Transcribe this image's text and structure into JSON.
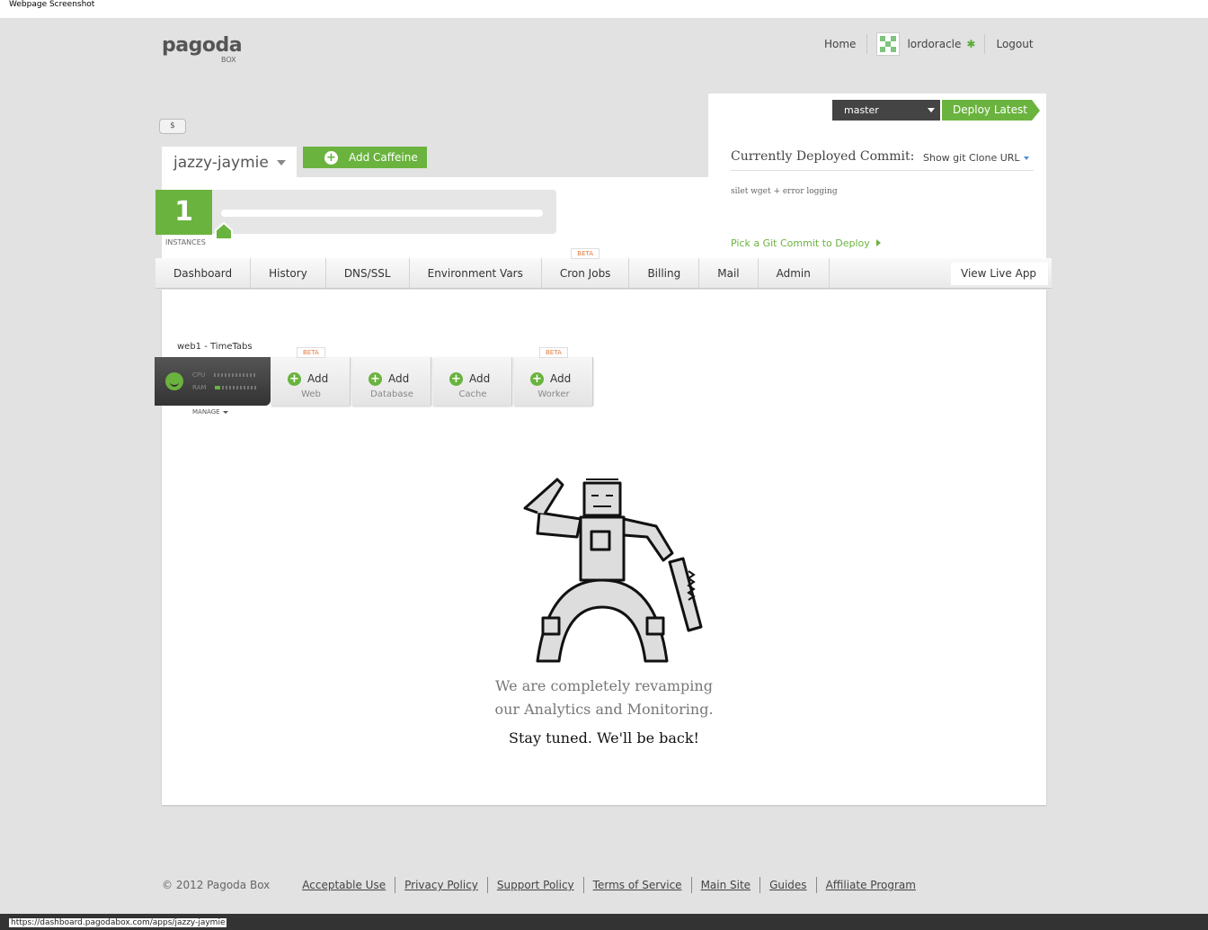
{
  "window": {
    "title": "Webpage Screenshot",
    "status_url": "https://dashboard.pagodabox.com/apps/jazzy-jaymie"
  },
  "logo": {
    "main": "pagoda",
    "sub": "BOX"
  },
  "topnav": {
    "home": "Home",
    "user": "lordoracle",
    "logout": "Logout"
  },
  "app": {
    "dollar": "$",
    "name": "jazzy-jaymie",
    "add_caffeine": "Add Caffeine",
    "instances_count": "1",
    "instances_label": "INSTANCES"
  },
  "deploy": {
    "branch": "master",
    "deploy_latest": "Deploy Latest",
    "current_commit_label": "Currently Deployed Commit:",
    "show_git_clone": "Show git Clone URL",
    "commit_message": "silet wget + error logging",
    "pick_commit": "Pick a Git Commit to Deploy"
  },
  "nav": {
    "tabs": [
      {
        "label": "Dashboard",
        "badge": ""
      },
      {
        "label": "History",
        "badge": ""
      },
      {
        "label": "DNS/SSL",
        "badge": ""
      },
      {
        "label": "Environment Vars",
        "badge": ""
      },
      {
        "label": "Cron Jobs",
        "badge": "BETA"
      },
      {
        "label": "Billing",
        "badge": ""
      },
      {
        "label": "Mail",
        "badge": ""
      },
      {
        "label": "Admin",
        "badge": ""
      }
    ],
    "view_live": "View Live App"
  },
  "components": {
    "web1_label": "web1 - TimeTabs",
    "cpu": "CPU",
    "ram": "RAM",
    "manage": "MANAGE",
    "add_label": "Add",
    "add_web": "Web",
    "add_database": "Database",
    "add_cache": "Cache",
    "add_worker": "Worker",
    "beta": "BETA"
  },
  "message": {
    "line1": "We are completely revamping our Analytics and Monitoring.",
    "line2": "Stay tuned. We'll be back!"
  },
  "footer": {
    "copyright": "© 2012 Pagoda Box",
    "links": [
      "Acceptable Use",
      "Privacy Policy",
      "Support Policy",
      "Terms of Service",
      "Main Site",
      "Guides",
      "Affiliate Program"
    ]
  },
  "colors": {
    "accent": "#6ab33e",
    "background": "#e2e2e2",
    "dark": "#444444",
    "beta": "#e07a3a"
  }
}
